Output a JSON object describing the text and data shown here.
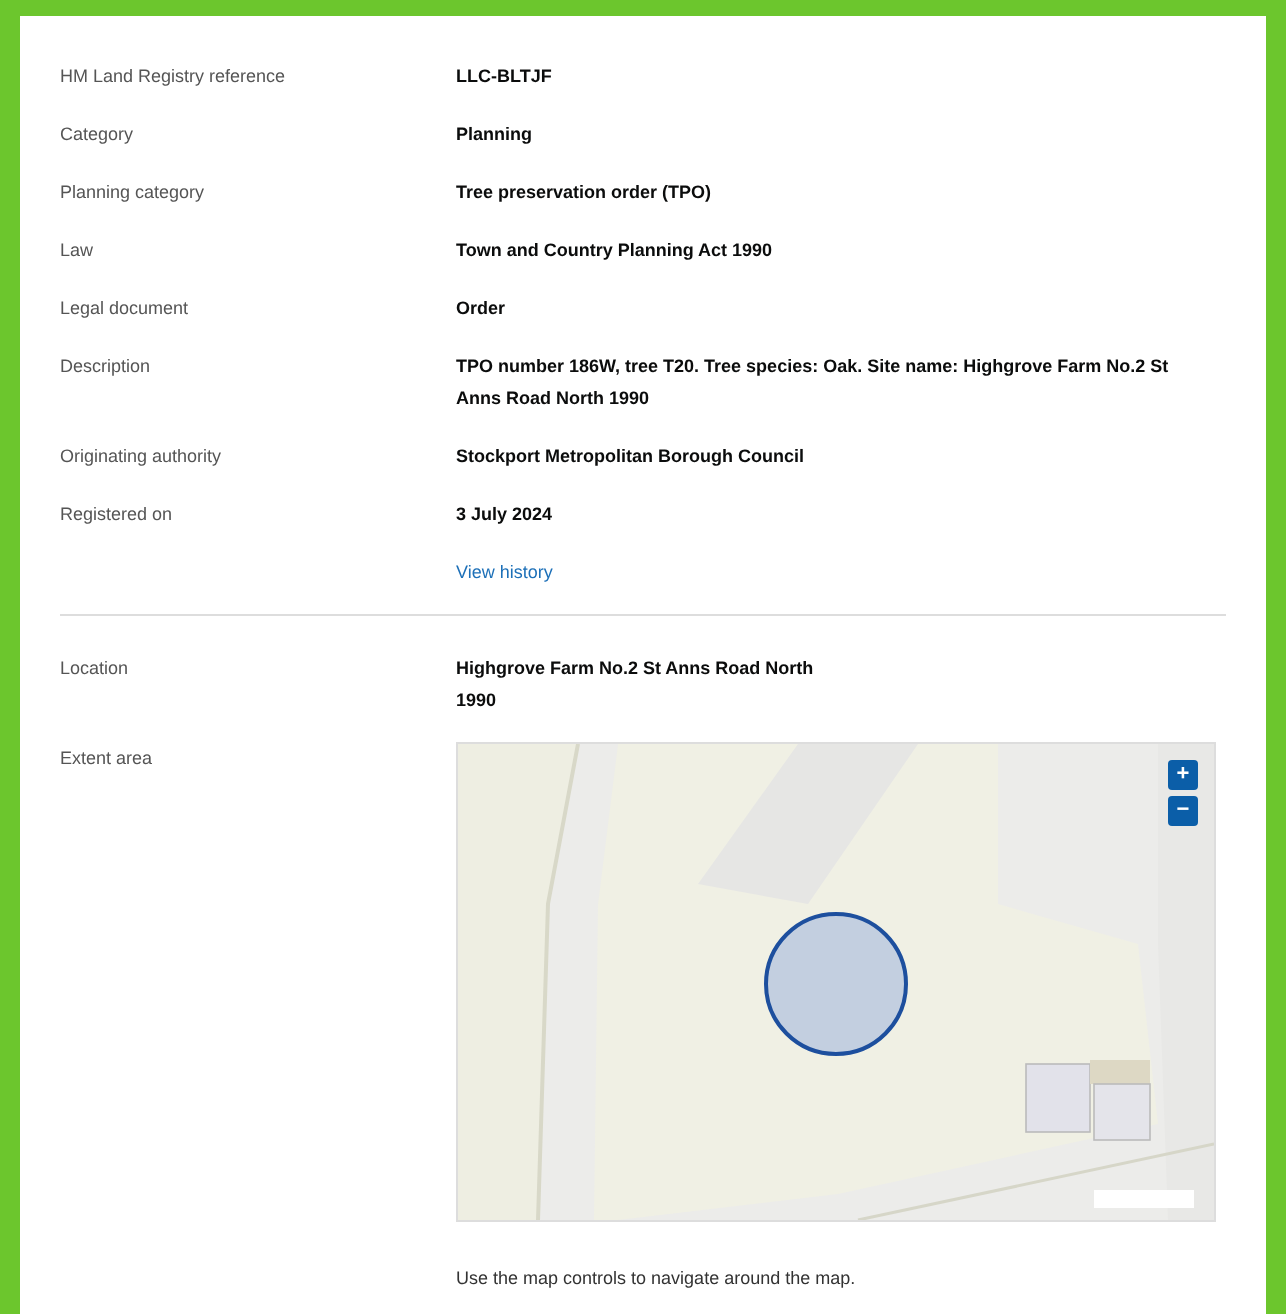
{
  "details": [
    {
      "label": "HM Land Registry reference",
      "value": "LLC-BLTJF"
    },
    {
      "label": "Category",
      "value": "Planning"
    },
    {
      "label": "Planning category",
      "value": "Tree preservation order (TPO)"
    },
    {
      "label": "Law",
      "value": "Town and Country Planning Act 1990"
    },
    {
      "label": "Legal document",
      "value": "Order"
    },
    {
      "label": "Description",
      "value": "TPO number 186W, tree T20. Tree species: Oak. Site name: Highgrove Farm No.2 St Anns Road North 1990"
    },
    {
      "label": "Originating authority",
      "value": "Stockport Metropolitan Borough Council"
    },
    {
      "label": "Registered on",
      "value": "3 July 2024"
    }
  ],
  "history_link": "View history",
  "location": {
    "label": "Location",
    "value": "Highgrove Farm No.2 St Anns Road North 1990"
  },
  "extent": {
    "label": "Extent area",
    "zoom_in": "+",
    "zoom_out": "−",
    "caption": "Use the map controls to navigate around the map."
  }
}
